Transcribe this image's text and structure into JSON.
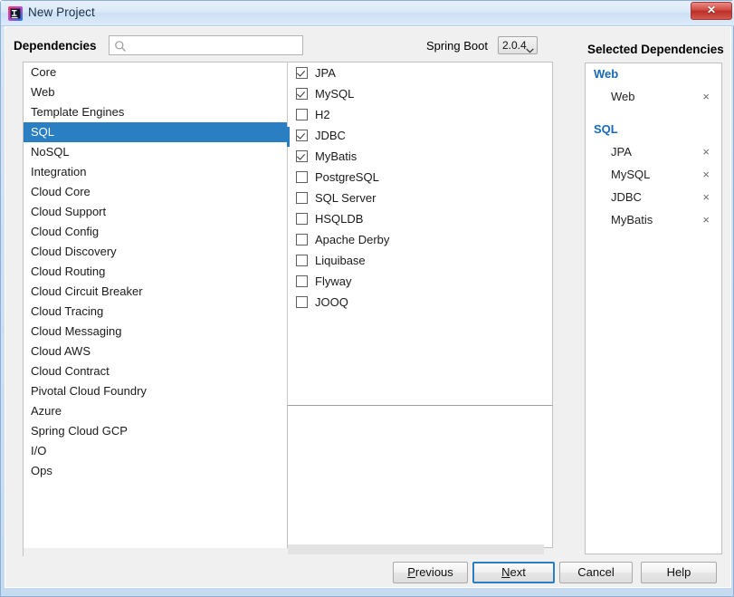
{
  "window": {
    "title": "New Project",
    "app_icon": "intellij-idea-icon",
    "close_label": "✕"
  },
  "toolbar": {
    "dependencies_label": "Dependencies",
    "search_placeholder": "",
    "search_value": "",
    "search_icon": "search-icon",
    "spring_boot_label": "Spring Boot",
    "spring_boot_version": "2.0.4",
    "spring_boot_options": [
      "2.0.4"
    ],
    "selected_dependencies_title": "Selected Dependencies"
  },
  "categories": [
    {
      "label": "Core",
      "selected": false
    },
    {
      "label": "Web",
      "selected": false
    },
    {
      "label": "Template Engines",
      "selected": false
    },
    {
      "label": "SQL",
      "selected": true
    },
    {
      "label": "NoSQL",
      "selected": false
    },
    {
      "label": "Integration",
      "selected": false
    },
    {
      "label": "Cloud Core",
      "selected": false
    },
    {
      "label": "Cloud Support",
      "selected": false
    },
    {
      "label": "Cloud Config",
      "selected": false
    },
    {
      "label": "Cloud Discovery",
      "selected": false
    },
    {
      "label": "Cloud Routing",
      "selected": false
    },
    {
      "label": "Cloud Circuit Breaker",
      "selected": false
    },
    {
      "label": "Cloud Tracing",
      "selected": false
    },
    {
      "label": "Cloud Messaging",
      "selected": false
    },
    {
      "label": "Cloud AWS",
      "selected": false
    },
    {
      "label": "Cloud Contract",
      "selected": false
    },
    {
      "label": "Pivotal Cloud Foundry",
      "selected": false
    },
    {
      "label": "Azure",
      "selected": false
    },
    {
      "label": "Spring Cloud GCP",
      "selected": false
    },
    {
      "label": "I/O",
      "selected": false
    },
    {
      "label": "Ops",
      "selected": false
    }
  ],
  "dependencies": [
    {
      "label": "JPA",
      "checked": true
    },
    {
      "label": "MySQL",
      "checked": true
    },
    {
      "label": "H2",
      "checked": false
    },
    {
      "label": "JDBC",
      "checked": true
    },
    {
      "label": "MyBatis",
      "checked": true
    },
    {
      "label": "PostgreSQL",
      "checked": false
    },
    {
      "label": "SQL Server",
      "checked": false
    },
    {
      "label": "HSQLDB",
      "checked": false
    },
    {
      "label": "Apache Derby",
      "checked": false
    },
    {
      "label": "Liquibase",
      "checked": false
    },
    {
      "label": "Flyway",
      "checked": false
    },
    {
      "label": "JOOQ",
      "checked": false
    }
  ],
  "selected_dependencies": [
    {
      "group": "Web",
      "items": [
        {
          "label": "Web",
          "remove": "×"
        }
      ]
    },
    {
      "group": "SQL",
      "items": [
        {
          "label": "JPA",
          "remove": "×"
        },
        {
          "label": "MySQL",
          "remove": "×"
        },
        {
          "label": "JDBC",
          "remove": "×"
        },
        {
          "label": "MyBatis",
          "remove": "×"
        }
      ]
    }
  ],
  "buttons": {
    "previous": {
      "prefix": "",
      "mnemonic": "P",
      "suffix": "revious"
    },
    "next": {
      "prefix": "",
      "mnemonic": "N",
      "suffix": "ext",
      "focused": true
    },
    "cancel": {
      "label": "Cancel"
    },
    "help": {
      "label": "Help"
    }
  },
  "colors": {
    "selection_blue": "#2a7fc2",
    "group_header_blue": "#1868b7",
    "close_red": "#bb2f27"
  }
}
